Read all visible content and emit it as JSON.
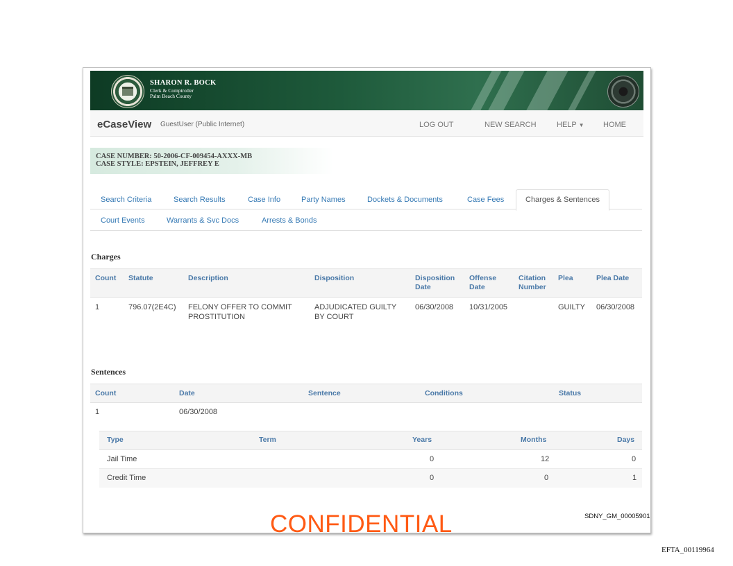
{
  "banner": {
    "name": "SHARON R. BOCK",
    "title": "Clerk & Comptroller",
    "county": "Palm Beach County"
  },
  "navbar": {
    "brand": "eCaseView",
    "user": "GuestUser (Public Internet)",
    "logout": "LOG OUT",
    "new_search": "NEW SEARCH",
    "help": "HELP",
    "home": "HOME"
  },
  "case": {
    "number": "CASE NUMBER: 50-2006-CF-009454-AXXX-MB",
    "style": "CASE STYLE: EPSTEIN, JEFFREY E"
  },
  "tabs": [
    "Search Criteria",
    "Search Results",
    "Case Info",
    "Party Names",
    "Dockets & Documents",
    "Case Fees",
    "Charges & Sentences",
    "Court Events",
    "Warrants & Svc Docs",
    "Arrests & Bonds"
  ],
  "charges": {
    "title": "Charges",
    "headers": {
      "count": "Count",
      "statute": "Statute",
      "description": "Description",
      "disposition": "Disposition",
      "disp_date_1": "Disposition",
      "disp_date_2": "Date",
      "offense_1": "Offense",
      "offense_2": "Date",
      "citation_1": "Citation",
      "citation_2": "Number",
      "plea": "Plea",
      "plea_date": "Plea Date"
    },
    "rows": [
      {
        "count": "1",
        "statute": "796.07(2E4C)",
        "description_1": "FELONY OFFER TO COMMIT",
        "description_2": "PROSTITUTION",
        "disposition_1": "ADJUDICATED GUILTY",
        "disposition_2": "BY COURT",
        "disposition_date": "06/30/2008",
        "offense_date": "10/31/2005",
        "citation": "",
        "plea": "GUILTY",
        "plea_date": "06/30/2008"
      }
    ]
  },
  "sentences": {
    "title": "Sentences",
    "headers": {
      "count": "Count",
      "date": "Date",
      "sentence": "Sentence",
      "conditions": "Conditions",
      "status": "Status"
    },
    "row": {
      "count": "1",
      "date": "06/30/2008"
    },
    "detail_headers": {
      "type": "Type",
      "term": "Term",
      "years": "Years",
      "months": "Months",
      "days": "Days"
    },
    "detail_rows": [
      {
        "type": "Jail Time",
        "years": "0",
        "months": "12",
        "days": "0"
      },
      {
        "type": "Credit Time",
        "years": "0",
        "months": "0",
        "days": "1"
      }
    ]
  },
  "footer": {
    "confidential": "CONFIDENTIAL",
    "bates": "SDNY_GM_00005901",
    "efta": "EFTA_00119964"
  },
  "colors": {
    "banner_green": "#1e5a3b",
    "link_blue": "#3579b4",
    "header_blue": "#4a79a8",
    "confidential_orange": "#ff5a14"
  }
}
